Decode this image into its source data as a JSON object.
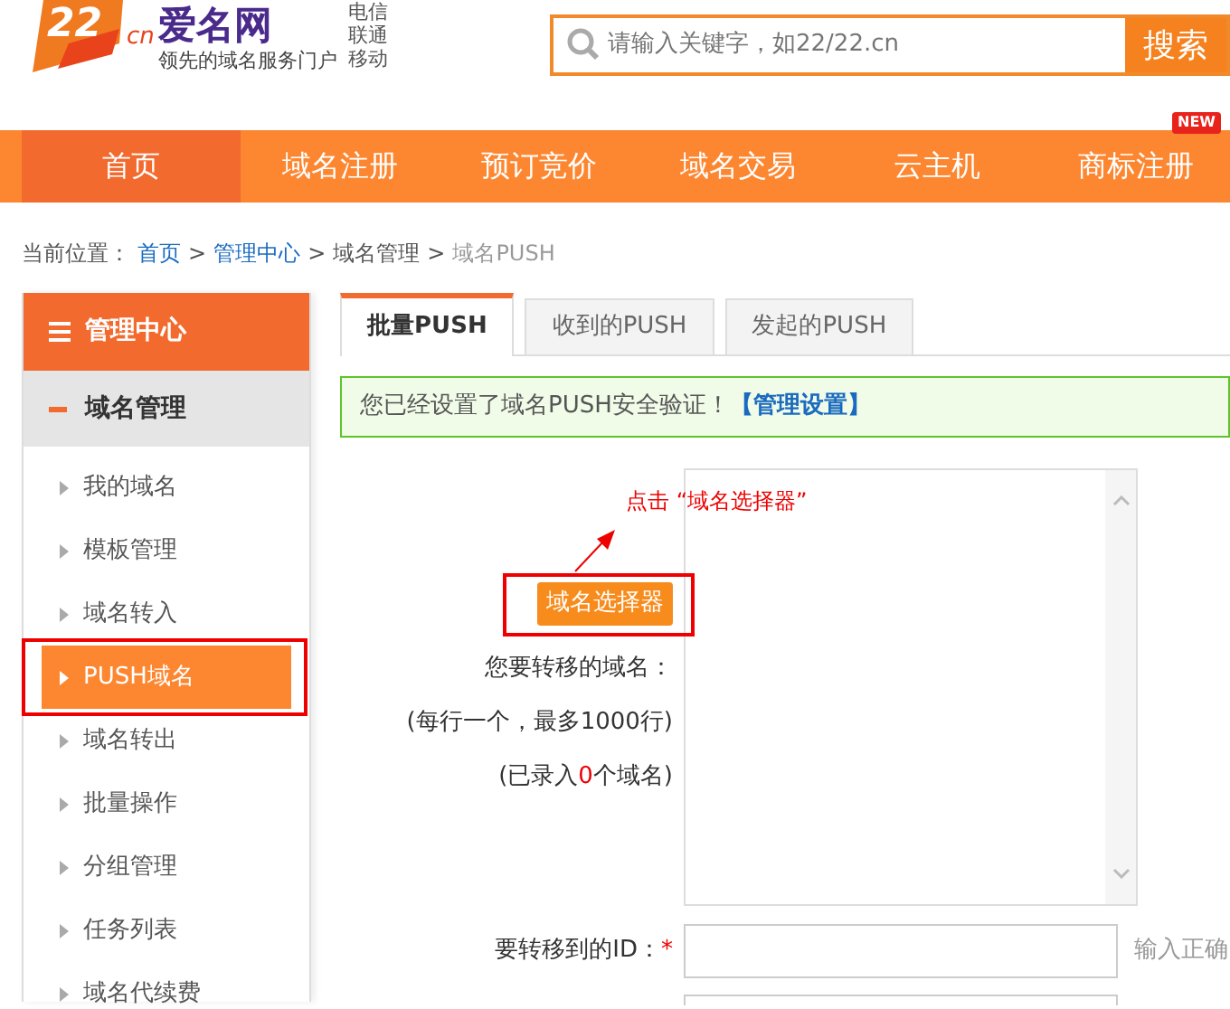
{
  "header": {
    "logo": {
      "mark": "22",
      "mark_suffix": "cn",
      "name": "爱名网",
      "slogan": "领先的域名服务门户",
      "carriers": [
        "电信",
        "联通",
        "移动"
      ]
    },
    "search": {
      "placeholder": "请输入关键字，如22/22.cn",
      "button": "搜索"
    }
  },
  "nav": [
    {
      "label": "首页",
      "selected": true
    },
    {
      "label": "域名注册",
      "selected": false
    },
    {
      "label": "预订竞价",
      "selected": false
    },
    {
      "label": "域名交易",
      "selected": false
    },
    {
      "label": "云主机",
      "selected": false
    },
    {
      "label": "商标注册",
      "selected": false,
      "badge": "NEW"
    }
  ],
  "breadcrumb": {
    "prefix": "当前位置：",
    "separator": ">",
    "items": [
      {
        "label": "首页",
        "kind": "link"
      },
      {
        "label": "管理中心",
        "kind": "link"
      },
      {
        "label": "域名管理",
        "kind": "text"
      },
      {
        "label": "域名PUSH",
        "kind": "current"
      }
    ]
  },
  "sidebar": {
    "title": "管理中心",
    "section": "域名管理",
    "items": [
      {
        "label": "我的域名",
        "selected": false,
        "highlighted": false
      },
      {
        "label": "模板管理",
        "selected": false,
        "highlighted": false
      },
      {
        "label": "域名转入",
        "selected": false,
        "highlighted": false
      },
      {
        "label": "PUSH域名",
        "selected": true,
        "highlighted": true
      },
      {
        "label": "域名转出",
        "selected": false,
        "highlighted": false
      },
      {
        "label": "批量操作",
        "selected": false,
        "highlighted": false
      },
      {
        "label": "分组管理",
        "selected": false,
        "highlighted": false
      },
      {
        "label": "任务列表",
        "selected": false,
        "highlighted": false
      },
      {
        "label": "域名代续费",
        "selected": false,
        "highlighted": false
      }
    ]
  },
  "tabs": [
    {
      "label": "批量PUSH",
      "selected": true
    },
    {
      "label": "收到的PUSH",
      "selected": false
    },
    {
      "label": "发起的PUSH",
      "selected": false
    }
  ],
  "alert": {
    "text": "您已经设置了域名PUSH安全验证！",
    "link": "【管理设置】"
  },
  "form": {
    "annotation": "点击 “域名选择器”",
    "picker_button": "域名选择器",
    "domains_label": "您要转移的域名：",
    "domains_hint": "(每行一个，最多1000行)",
    "count_prefix": "(已录入",
    "count": "0",
    "count_suffix": "个域名)",
    "id_label": "要转移到的ID：",
    "required_mark": "*",
    "id_hint": "输入正确"
  }
}
